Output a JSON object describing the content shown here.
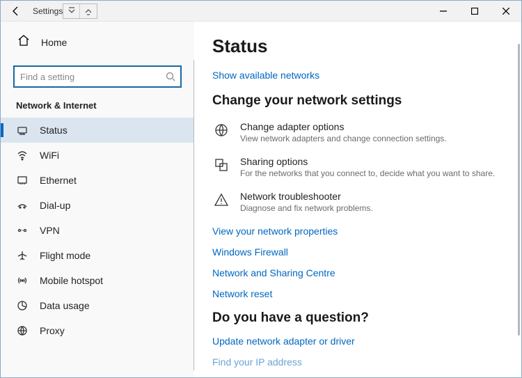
{
  "titlebar": {
    "title": "Settings"
  },
  "sidebar": {
    "home": "Home",
    "search_placeholder": "Find a setting",
    "section": "Network & Internet",
    "items": [
      {
        "label": "Status",
        "selected": true
      },
      {
        "label": "WiFi",
        "selected": false
      },
      {
        "label": "Ethernet",
        "selected": false
      },
      {
        "label": "Dial-up",
        "selected": false
      },
      {
        "label": "VPN",
        "selected": false
      },
      {
        "label": "Flight mode",
        "selected": false
      },
      {
        "label": "Mobile hotspot",
        "selected": false
      },
      {
        "label": "Data usage",
        "selected": false
      },
      {
        "label": "Proxy",
        "selected": false
      }
    ]
  },
  "main": {
    "title": "Status",
    "show_networks": "Show available networks",
    "change_settings_hdr": "Change your network settings",
    "options": [
      {
        "title": "Change adapter options",
        "desc": "View network adapters and change connection settings."
      },
      {
        "title": "Sharing options",
        "desc": "For the networks that you connect to, decide what you want to share."
      },
      {
        "title": "Network troubleshooter",
        "desc": "Diagnose and fix network problems."
      }
    ],
    "links": [
      "View your network properties",
      "Windows Firewall",
      "Network and Sharing Centre",
      "Network reset"
    ],
    "question_hdr": "Do you have a question?",
    "question_links": [
      "Update network adapter or driver",
      "Find your IP address"
    ]
  }
}
